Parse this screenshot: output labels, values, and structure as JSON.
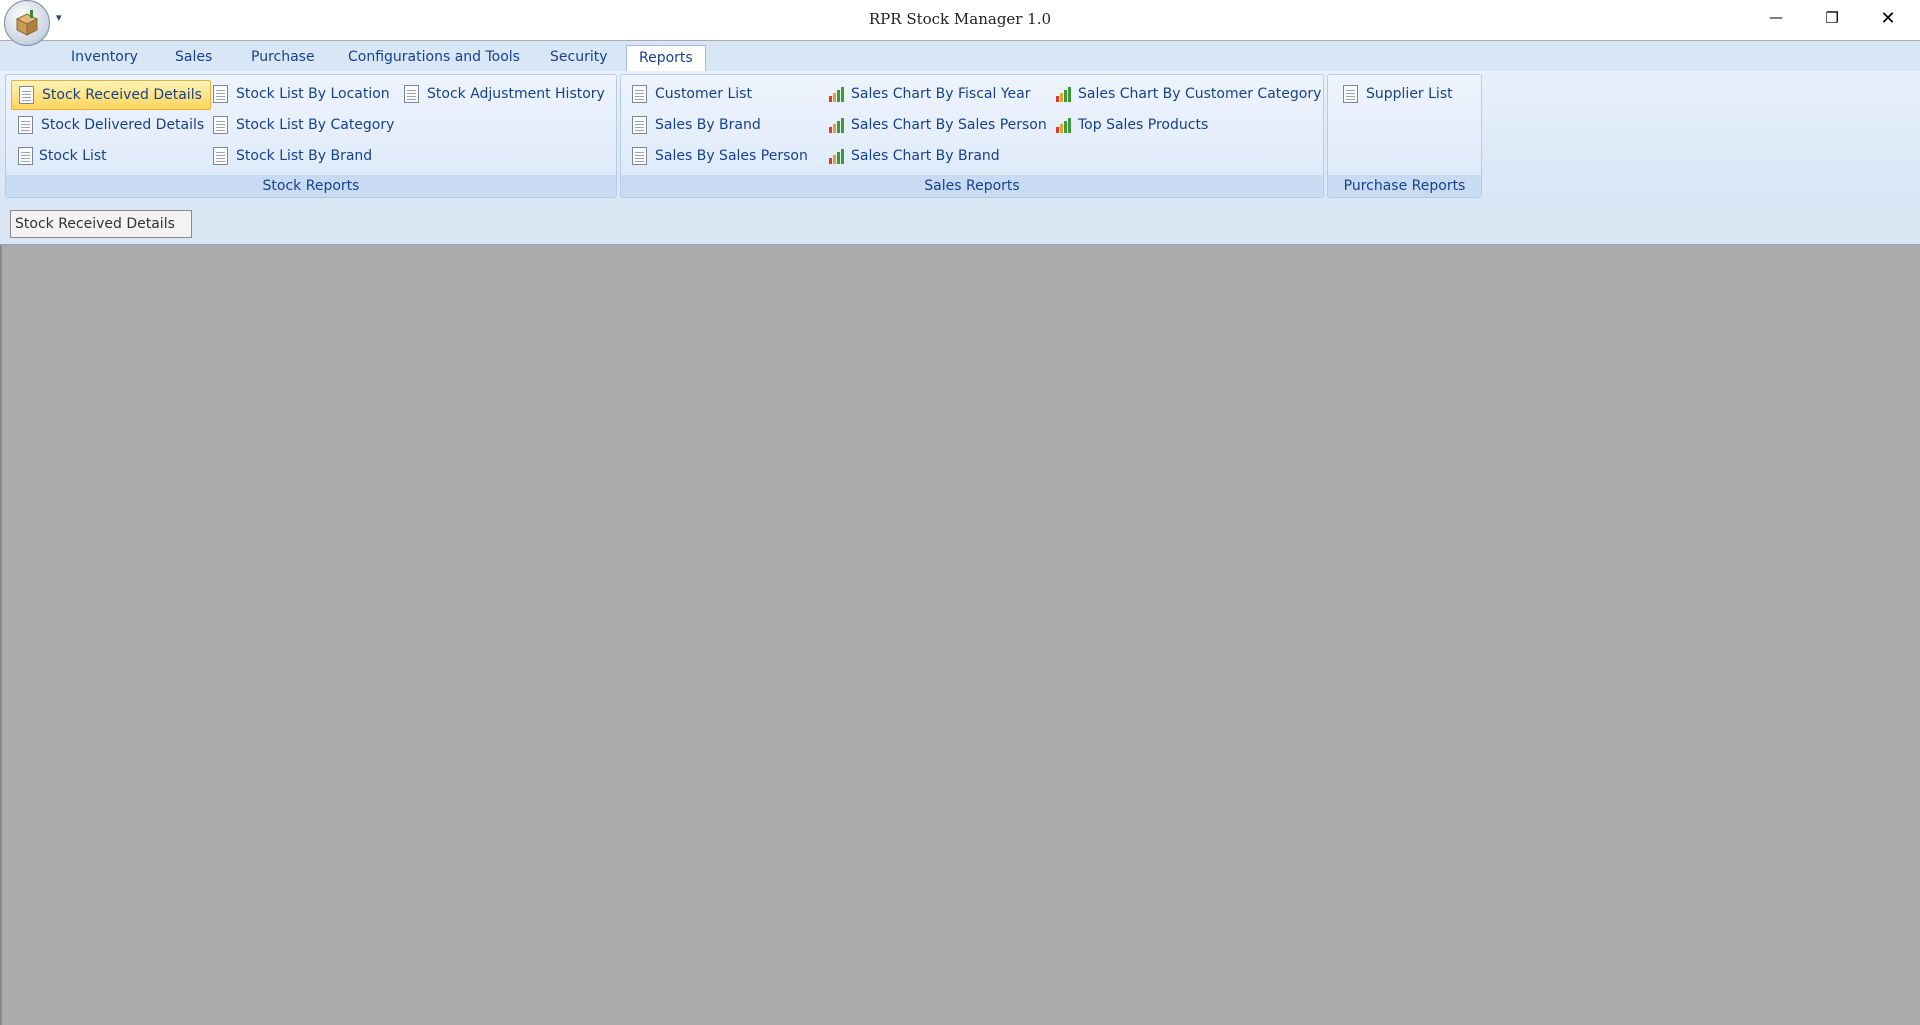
{
  "window": {
    "title": "RPR Stock Manager 1.0",
    "qat_arrow": "▾",
    "minimize_glyph": "—",
    "restore_glyph": "❐",
    "close_glyph": "✕",
    "app_icon": "package-icon"
  },
  "tabs": [
    "Inventory",
    "Sales",
    "Purchase",
    "Configurations and Tools",
    "Security",
    "Reports"
  ],
  "active_tab": "Reports",
  "ribbon": {
    "stock_reports": {
      "caption": "Stock Reports",
      "items": [
        "Stock Received Details",
        "Stock Delivered Details",
        "Stock List",
        "Stock List By Location",
        "Stock List By Category",
        "Stock List By Brand",
        "Stock Adjustment History"
      ],
      "selected": "Stock Received Details"
    },
    "sales_reports": {
      "caption": "Sales Reports",
      "items": [
        "Customer List",
        "Sales By Brand",
        "Sales By Sales Person",
        "Sales Chart By Fiscal Year",
        "Sales Chart By Sales Person",
        "Sales Chart By Brand",
        "Sales Chart By Customer Category",
        "Top Sales Products"
      ]
    },
    "purchase_reports": {
      "caption": "Purchase Reports",
      "items": [
        "Supplier List"
      ]
    }
  },
  "document_tab": "Stock Received Details",
  "icons": {
    "report": "report-document-icon",
    "chart": "bar-chart-icon"
  },
  "colors": {
    "ribbon_text": "#15428b",
    "selected_fill": "#ffd55c",
    "workspace": "#ababab"
  }
}
